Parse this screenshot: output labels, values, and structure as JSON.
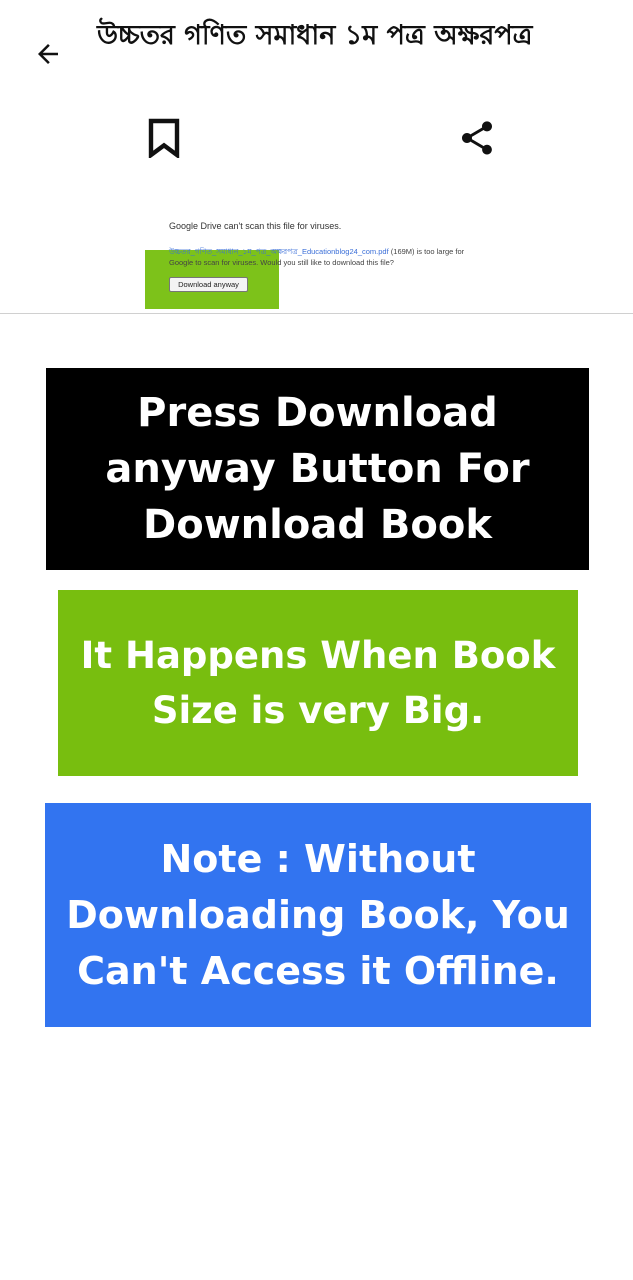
{
  "header": {
    "title": "উচ্চতর গণিত সমাধান ১ম পত্র অক্ষরপত্র",
    "icons": {
      "back": "arrow-left-icon",
      "bookmark": "bookmark-icon",
      "share": "share-icon"
    }
  },
  "drive_notice": {
    "message": "Google Drive can't scan this file for viruses.",
    "file_name": "উচ্চতর_গণিত_সমাধান_১ম_পত্র_অক্ষরপত্র_Educationblog24_com.pdf",
    "info_text": " (169M) is too large for Google to scan for viruses. Would you still like to download this file?",
    "download_button": "Download anyway",
    "highlight_color": "#7dc21a"
  },
  "banners": {
    "black": "Press Download anyway Button For Download Book",
    "green": "It Happens When Book Size is very Big.",
    "blue": "Note : Without Downloading Book, You Can't Access it Offline.",
    "colors": {
      "black": "#000000",
      "green": "#78be0f",
      "blue": "#3274f0"
    }
  }
}
